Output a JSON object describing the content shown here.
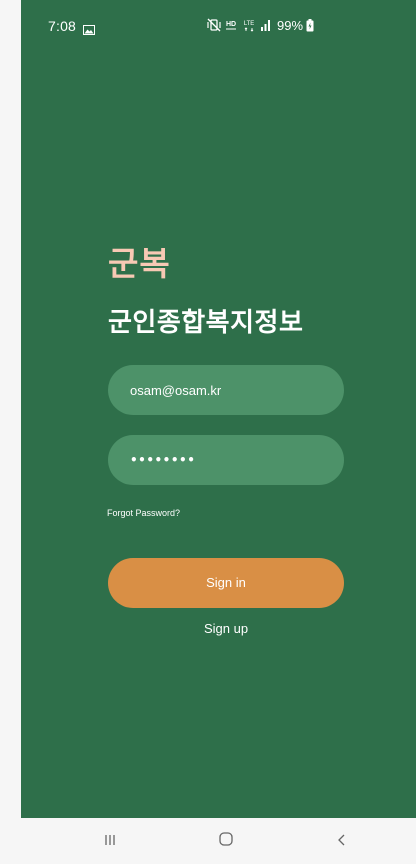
{
  "status_bar": {
    "time": "7:08",
    "battery": "99%",
    "icons": [
      "gallery-icon",
      "mute-vibrate-icon",
      "hd-voice-icon",
      "lte-icon",
      "signal-icon",
      "battery-icon"
    ],
    "hd_label": "HD",
    "lte_label": "LTE"
  },
  "app": {
    "brand": "군복",
    "subtitle": "군인종합복지정보"
  },
  "form": {
    "email_value": "osam@osam.kr",
    "password_value": "••••••••",
    "forgot_password": "Forgot Password?",
    "sign_in": "Sign in",
    "sign_up": "Sign up"
  },
  "nav_bar": {
    "icons": [
      "recent-apps-icon",
      "home-icon",
      "back-icon"
    ]
  },
  "colors": {
    "background": "#2e6f4a",
    "brand": "#f7c9b4",
    "input": "#4d9269",
    "button": "#d98f45",
    "nav": "#f6f6f6"
  }
}
